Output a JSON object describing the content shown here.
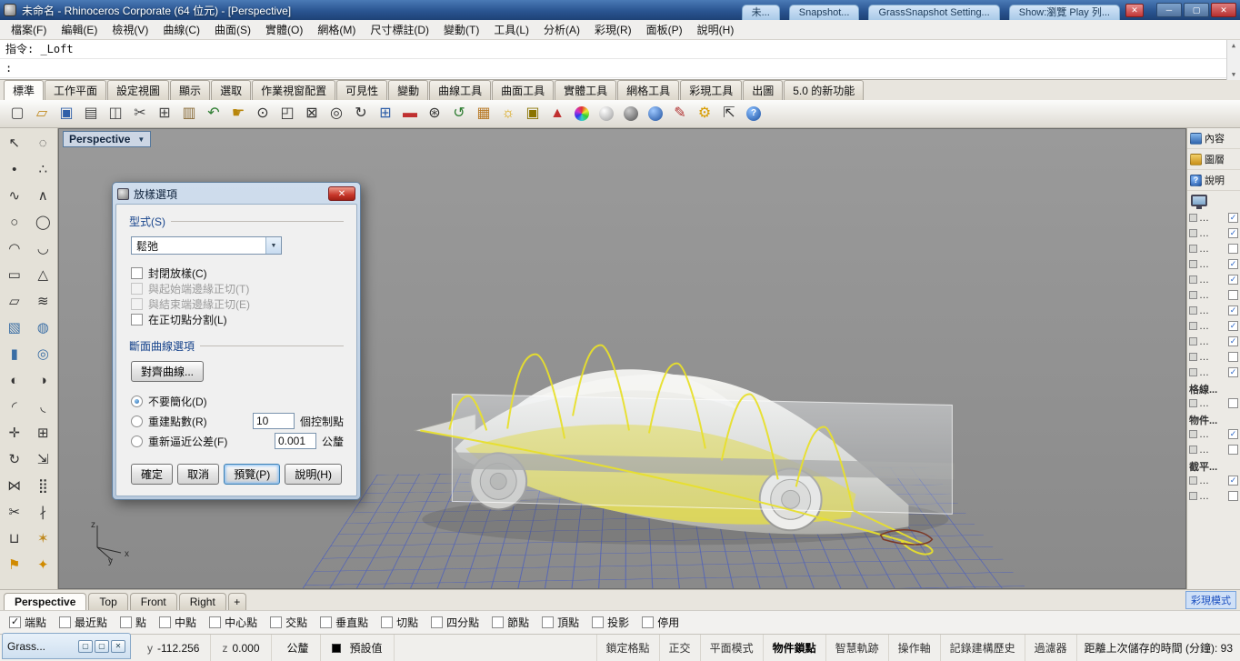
{
  "icons": {
    "dropdown": "▼",
    "close": "✕",
    "minimize": "─",
    "maximize": "▢",
    "up": "▲",
    "down": "▼"
  },
  "window": {
    "title": "未命名 - Rhinoceros Corporate (64 位元) - [Perspective]",
    "background_tabs": [
      {
        "label": "未..."
      },
      {
        "label": "Snapshot..."
      },
      {
        "label": "GrassSnapshot Setting..."
      },
      {
        "label": "Show:瀏覽 Play 列..."
      }
    ]
  },
  "menu": {
    "items": [
      "檔案(F)",
      "編輯(E)",
      "檢視(V)",
      "曲線(C)",
      "曲面(S)",
      "實體(O)",
      "網格(M)",
      "尺寸標註(D)",
      "變動(T)",
      "工具(L)",
      "分析(A)",
      "彩現(R)",
      "面板(P)",
      "說明(H)"
    ]
  },
  "command": {
    "line1": "指令: _Loft",
    "line2": ":"
  },
  "ribbon": {
    "tabs": [
      {
        "label": "標準",
        "active": true
      },
      {
        "label": "工作平面"
      },
      {
        "label": "設定視圖"
      },
      {
        "label": "顯示"
      },
      {
        "label": "選取"
      },
      {
        "label": "作業視窗配置"
      },
      {
        "label": "可見性"
      },
      {
        "label": "變動"
      },
      {
        "label": "曲線工具"
      },
      {
        "label": "曲面工具"
      },
      {
        "label": "實體工具"
      },
      {
        "label": "網格工具"
      },
      {
        "label": "彩現工具"
      },
      {
        "label": "出圖"
      },
      {
        "label": "5.0 的新功能"
      }
    ]
  },
  "toolbar": {
    "icons": [
      {
        "name": "new-file-icon",
        "glyph": "▢",
        "fg": "#4a4a4a"
      },
      {
        "name": "open-file-icon",
        "glyph": "▱",
        "fg": "#c08a20"
      },
      {
        "name": "save-icon",
        "glyph": "▣",
        "fg": "#2f5fa8"
      },
      {
        "name": "print-icon",
        "glyph": "▤",
        "fg": "#4a4a4a"
      },
      {
        "name": "screenshot-icon",
        "glyph": "◫",
        "fg": "#4a4a4a"
      },
      {
        "name": "cut-icon",
        "glyph": "✂",
        "fg": "#4a4a4a"
      },
      {
        "name": "copy-icon",
        "glyph": "⊞",
        "fg": "#4a4a4a"
      },
      {
        "name": "paste-icon",
        "glyph": "▥",
        "fg": "#8a6d3b"
      },
      {
        "name": "undo-icon",
        "glyph": "↶",
        "fg": "#2e7d32"
      },
      {
        "name": "pan-icon",
        "glyph": "☛",
        "fg": "#b8860b"
      },
      {
        "name": "zoom-dynamic-icon",
        "glyph": "⊙",
        "fg": "#333333"
      },
      {
        "name": "zoom-window-icon",
        "glyph": "◰",
        "fg": "#333333"
      },
      {
        "name": "zoom-extents-icon",
        "glyph": "⊠",
        "fg": "#333333"
      },
      {
        "name": "zoom-selected-icon",
        "glyph": "◎",
        "fg": "#333333"
      },
      {
        "name": "rotate-view-icon",
        "glyph": "↻",
        "fg": "#333333"
      },
      {
        "name": "viewport-layout-icon",
        "glyph": "⊞",
        "fg": "#2f5fa8"
      },
      {
        "name": "car-display-icon",
        "glyph": "▬",
        "fg": "#c03030"
      },
      {
        "name": "zoom-target-icon",
        "glyph": "⊛",
        "fg": "#333333"
      },
      {
        "name": "undo-view-icon",
        "glyph": "↺",
        "fg": "#2e7d32"
      },
      {
        "name": "named-view-icon",
        "glyph": "▦",
        "fg": "#b87a28"
      },
      {
        "name": "lamp-icon",
        "glyph": "☼",
        "fg": "#d8a000"
      },
      {
        "name": "lock-icon",
        "glyph": "▣",
        "fg": "#8a7400"
      },
      {
        "name": "render-icon",
        "glyph": "▲",
        "fg": "#c03030"
      },
      {
        "name": "color-wheel-icon",
        "ball": true,
        "bg": "conic-gradient(#e33333,#eeee33,#33cc33,#33cccc,#3333ee,#cc33cc,#e33333)"
      },
      {
        "name": "render-sphere-light-icon",
        "ball": true,
        "bg": "radial-gradient(circle at 35% 30%, #ffffff, #9a9a9a)"
      },
      {
        "name": "render-sphere-dark-icon",
        "ball": true,
        "bg": "radial-gradient(circle at 35% 30%, #cccccc, #4f4f4f)"
      },
      {
        "name": "render-sphere-blue-icon",
        "ball": true,
        "bg": "radial-gradient(circle at 35% 30%, #9ec8ff, #1c4e9c)"
      },
      {
        "name": "pen-settings-icon",
        "glyph": "✎",
        "fg": "#b03030"
      },
      {
        "name": "options-gear-icon",
        "glyph": "⚙",
        "fg": "#d89c00"
      },
      {
        "name": "gumball-icon",
        "glyph": "⇱",
        "fg": "#333333"
      },
      {
        "name": "help-icon",
        "ball": true,
        "bg": "radial-gradient(circle at 35% 30%, #8cc0ff, #1a4fa0)",
        "glyph": "?",
        "fg": "#ffffff"
      }
    ]
  },
  "left_toolbar": {
    "icons": [
      {
        "name": "select-tool-icon",
        "glyph": "↖"
      },
      {
        "name": "lasso-select-icon",
        "glyph": "◌"
      },
      {
        "name": "point-icon",
        "glyph": "•"
      },
      {
        "name": "points-icon",
        "glyph": "∴"
      },
      {
        "name": "curve-icon",
        "glyph": "∿"
      },
      {
        "name": "polyline-icon",
        "glyph": "∧"
      },
      {
        "name": "circle-icon",
        "glyph": "○"
      },
      {
        "name": "ellipse-icon",
        "glyph": "◯"
      },
      {
        "name": "arc-icon",
        "glyph": "◠"
      },
      {
        "name": "conic-icon",
        "glyph": "◡"
      },
      {
        "name": "rectangle-icon",
        "glyph": "▭"
      },
      {
        "name": "polygon-icon",
        "glyph": "△"
      },
      {
        "name": "surface-icon",
        "glyph": "▱"
      },
      {
        "name": "loft-icon",
        "glyph": "≋"
      },
      {
        "name": "box-icon",
        "glyph": "▧",
        "fg": "#3a6ea5"
      },
      {
        "name": "sphere-icon",
        "glyph": "◍",
        "fg": "#3a6ea5"
      },
      {
        "name": "cylinder-icon",
        "glyph": "▮",
        "fg": "#3a6ea5"
      },
      {
        "name": "torus-icon",
        "glyph": "◎",
        "fg": "#3a6ea5"
      },
      {
        "name": "boolean-union-icon",
        "glyph": "◐"
      },
      {
        "name": "boolean-difference-icon",
        "glyph": "◑"
      },
      {
        "name": "fillet-icon",
        "glyph": "◜"
      },
      {
        "name": "chamfer-icon",
        "glyph": "◟"
      },
      {
        "name": "move-icon",
        "glyph": "✛"
      },
      {
        "name": "copy-object-icon",
        "glyph": "⊞"
      },
      {
        "name": "rotate-icon",
        "glyph": "↻"
      },
      {
        "name": "scale-icon",
        "glyph": "⇲"
      },
      {
        "name": "mirror-icon",
        "glyph": "⋈"
      },
      {
        "name": "array-icon",
        "glyph": "⣿"
      },
      {
        "name": "trim-icon",
        "glyph": "✂"
      },
      {
        "name": "split-icon",
        "glyph": "∤"
      },
      {
        "name": "join-icon",
        "glyph": "⊔"
      },
      {
        "name": "explode-icon",
        "glyph": "✶",
        "fg": "#c08a20"
      },
      {
        "name": "flag-icon",
        "glyph": "⚑",
        "fg": "#d08a00"
      },
      {
        "name": "paint-icon",
        "glyph": "✦",
        "fg": "#d08a00"
      }
    ]
  },
  "viewport": {
    "label": "Perspective",
    "axis": {
      "x": "x",
      "y": "y",
      "z": "z"
    }
  },
  "dialog": {
    "title": "放樣選項",
    "style_label": "型式(S)",
    "style_value": "鬆弛",
    "checkboxes": [
      {
        "label": "封閉放樣(C)"
      },
      {
        "label": "與起始端邊緣正切(T)",
        "disabled": true
      },
      {
        "label": "與結束端邊緣正切(E)",
        "disabled": true
      },
      {
        "label": "在正切點分割(L)"
      }
    ],
    "section": "斷面曲線選項",
    "align_button": "對齊曲線...",
    "radios": [
      {
        "label": "不要簡化(D)",
        "selected": true
      },
      {
        "label": "重建點數(R)",
        "has_input": true,
        "value": "10",
        "suffix": "個控制點"
      },
      {
        "label": "重新逼近公差(F)",
        "has_input": true,
        "value": "0.001",
        "suffix": "公釐"
      }
    ],
    "buttons": [
      {
        "label": "確定",
        "name": "ok-button"
      },
      {
        "label": "取消",
        "name": "cancel-button"
      },
      {
        "label": "預覽(P)",
        "name": "preview-button",
        "default": true
      },
      {
        "label": "說明(H)",
        "name": "help-button"
      }
    ]
  },
  "right_panel": {
    "tabs": [
      {
        "name": "panel-tab-properties",
        "label": "內容",
        "icon_bg": "linear-gradient(#86b8ec,#2f64ad)",
        "icon_glyph": "",
        "icon_fg": "#ffffff"
      },
      {
        "name": "panel-tab-layers",
        "label": "圖層",
        "icon_bg": "linear-gradient(#f3d06a,#c89018)",
        "icon_glyph": "",
        "icon_fg": "#ffffff"
      },
      {
        "name": "panel-tab-help",
        "label": "說明",
        "icon_bg": "radial-gradient(circle at 35% 30%, #8cc0ff, #1a4fa0)",
        "icon_glyph": "?",
        "icon_fg": "#ffffff"
      }
    ],
    "items": [
      {
        "label": "…",
        "checked": true
      },
      {
        "label": "…",
        "checked": true
      },
      {
        "label": "…"
      },
      {
        "label": "…",
        "checked": true
      },
      {
        "label": "…",
        "checked": true
      },
      {
        "label": "…"
      },
      {
        "label": "…",
        "checked": true
      },
      {
        "label": "…",
        "checked": true
      },
      {
        "label": "…",
        "checked": true
      },
      {
        "label": "…"
      },
      {
        "label": "…",
        "checked": true
      },
      {
        "header": true,
        "label": "格線..."
      },
      {
        "label": "…"
      },
      {
        "header": true,
        "label": "物件..."
      },
      {
        "label": "…",
        "checked": true
      },
      {
        "label": "…"
      },
      {
        "header": true,
        "label": "截平..."
      },
      {
        "label": "…",
        "checked": true
      },
      {
        "label": "…"
      }
    ],
    "footer": "彩現模式"
  },
  "viewport_tabs": {
    "tabs": [
      {
        "label": "Perspective",
        "active": true
      },
      {
        "label": "Top"
      },
      {
        "label": "Front"
      },
      {
        "label": "Right"
      }
    ],
    "add": "+"
  },
  "osnap": {
    "items": [
      {
        "label": "端點",
        "checked": true
      },
      {
        "label": "最近點"
      },
      {
        "label": "點"
      },
      {
        "label": "中點"
      },
      {
        "label": "中心點"
      },
      {
        "label": "交點"
      },
      {
        "label": "垂直點"
      },
      {
        "label": "切點"
      },
      {
        "label": "四分點"
      },
      {
        "label": "節點"
      },
      {
        "label": "頂點"
      },
      {
        "label": "投影"
      },
      {
        "label": "停用"
      }
    ]
  },
  "status": {
    "cells": [
      {
        "label": "y",
        "value": "-112.256"
      },
      {
        "label": "z",
        "value": "0.000"
      },
      {
        "label": "",
        "value": "公釐"
      },
      {
        "label": "",
        "value": "預設值",
        "has_swatch": true
      }
    ],
    "toggles": [
      {
        "label": "鎖定格點"
      },
      {
        "label": "正交"
      },
      {
        "label": "平面模式"
      },
      {
        "label": "物件鎖點",
        "active": true
      },
      {
        "label": "智慧軌跡"
      },
      {
        "label": "操作軸"
      },
      {
        "label": "記錄建構歷史"
      },
      {
        "label": "過濾器"
      }
    ],
    "timer": "距離上次儲存的時間 (分鐘): 93"
  },
  "grass": {
    "title": "Grass...",
    "buttons": [
      {
        "name": "popup-window-icon",
        "glyph": "▢"
      },
      {
        "name": "popup-window2-icon",
        "glyph": "▢"
      },
      {
        "name": "popup-close-icon",
        "glyph": "✕"
      }
    ]
  }
}
